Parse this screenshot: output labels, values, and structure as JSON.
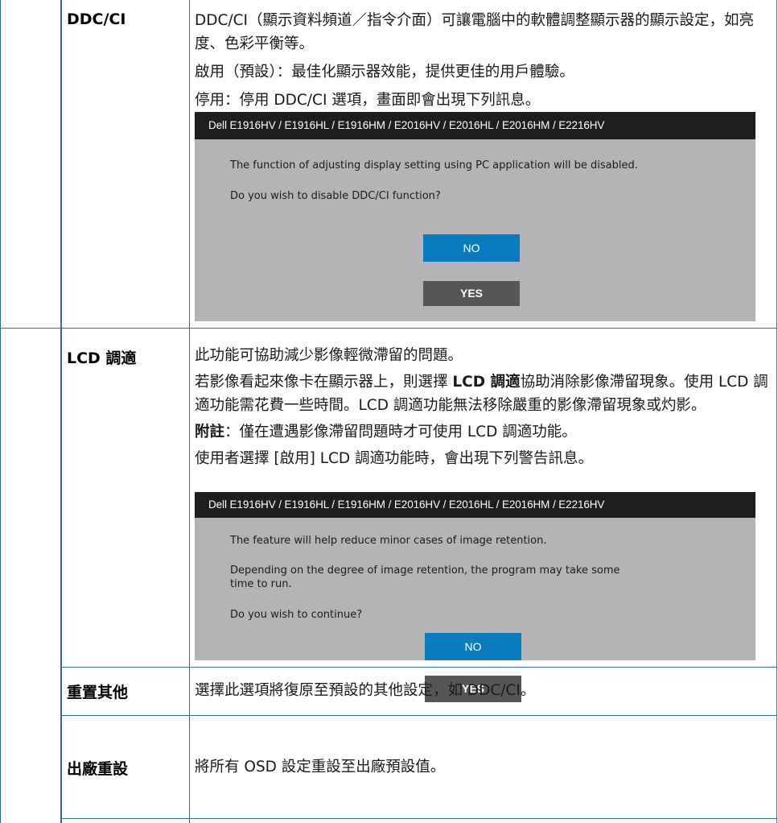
{
  "colors": {
    "border": "#2d6ca2",
    "dialog_bg": "#b4b4b4",
    "dialog_title_bg": "#1e1e1e",
    "no_button": "#0b7bc0",
    "yes_button": "#565656"
  },
  "rows": {
    "ddcci": {
      "label": "DDC/CI",
      "lines": [
        "DDC/CI（顯示資料頻道／指令介面）可讓電腦中的軟體調整顯示器的顯示設定，如亮度、色彩平衡等。",
        "啟用（預設）：最佳化顯示器效能，提供更佳的用戶體驗。",
        "停用：停用 DDC/CI 選項，畫面即會出現下列訊息。"
      ],
      "dialog": {
        "title": "Dell E1916HV / E1916HL / E1916HM / E2016HV / E2016HL / E2016HM / E2216HV",
        "message1": "The function of adjusting display setting using PC application will be disabled.",
        "message2": "Do you wish to disable DDC/CI function?",
        "no_label": "NO",
        "yes_label": "YES"
      }
    },
    "lcd": {
      "label": "LCD 調適",
      "line1": "此功能可協助減少影像輕微滯留的問題。",
      "line2_pre": "若影像看起來像卡在顯示器上，則選擇 ",
      "line2_bold": "LCD 調適",
      "line2_post": "協助消除影像滯留現象。使用 LCD 調適功能需花費一些時間。LCD 調適功能無法移除嚴重的影像滯留現象或灼影。",
      "note_label": "附註",
      "note_text": "：僅在遭遇影像滯留問題時才可使用 LCD 調適功能。",
      "line4": "使用者選擇 [啟用] LCD 調適功能時，會出現下列警告訊息。",
      "dialog": {
        "title": "Dell E1916HV / E1916HL / E1916HM / E2016HV / E2016HL / E2016HM / E2216HV",
        "message1": "The feature will help reduce minor cases of image retention.",
        "message2": "Depending on the degree of image retention, the program may take some time to run.",
        "message3": "Do you wish to continue?",
        "no_label": "NO",
        "yes_label": "YES"
      }
    },
    "reset_other": {
      "label": "重置其他",
      "text": "選擇此選項將復原至預設的其他設定，如 DDC/CI。"
    },
    "factory_reset": {
      "label": "出廠重設",
      "text": "將所有 OSD 設定重設至出廠預設值。"
    }
  }
}
